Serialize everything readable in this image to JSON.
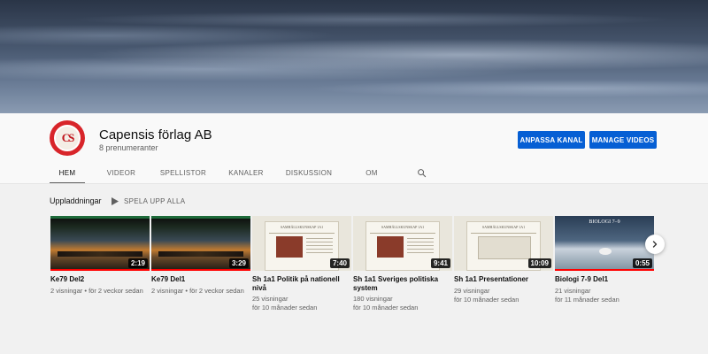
{
  "channel": {
    "name": "Capensis förlag AB",
    "subscribers": "8 prenumeranter",
    "avatar_letters": "CS"
  },
  "actions": {
    "customize_label": "ANPASSA KANAL",
    "manage_label": "MANAGE VIDEOS"
  },
  "tabs": [
    {
      "label": "HEM",
      "active": true
    },
    {
      "label": "VIDEOR",
      "active": false
    },
    {
      "label": "SPELLISTOR",
      "active": false
    },
    {
      "label": "KANALER",
      "active": false
    },
    {
      "label": "DISKUSSION",
      "active": false
    },
    {
      "label": "OM",
      "active": false
    }
  ],
  "section": {
    "title": "Uppladdningar",
    "play_all_label": "SPELA UPP ALLA"
  },
  "videos": [
    {
      "title": "Ke79 Del2",
      "views": "2 visningar",
      "age": "för 2 veckor sedan",
      "duration": "2:19",
      "watched": 1.0,
      "thumb_text": ""
    },
    {
      "title": "Ke79 Del1",
      "views": "2 visningar",
      "age": "för 2 veckor sedan",
      "duration": "3:29",
      "watched": 1.0,
      "thumb_text": ""
    },
    {
      "title": "Sh 1a1 Politik på nationell nivå",
      "views": "25 visningar",
      "age": "för 10 månader sedan",
      "duration": "7:40",
      "watched": 0.0,
      "thumb_text": "SAMHÄLLSKUNSKAP 1A1"
    },
    {
      "title": "Sh 1a1 Sveriges politiska system",
      "views": "180 visningar",
      "age": "för 10 månader sedan",
      "duration": "9:41",
      "watched": 0.0,
      "thumb_text": "SAMHÄLLSKUNSKAP 1A1"
    },
    {
      "title": "Sh 1a1 Presentationer",
      "views": "29 visningar",
      "age": "för 10 månader sedan",
      "duration": "10:09",
      "watched": 0.0,
      "thumb_text": "SAMHÄLLSKUNSKAP 1A1"
    },
    {
      "title": "Biologi 7-9 Del1",
      "views": "21 visningar",
      "age": "för 11 månader sedan",
      "duration": "0:55",
      "watched": 1.0,
      "thumb_text": "BIOLOGI 7–9"
    }
  ],
  "colors": {
    "primary_button": "#065fd4",
    "progress": "#ff0000",
    "avatar_ring": "#d8252a"
  },
  "icons": {
    "search": "search-icon",
    "play": "play-icon",
    "next": "chevron-right-icon"
  }
}
